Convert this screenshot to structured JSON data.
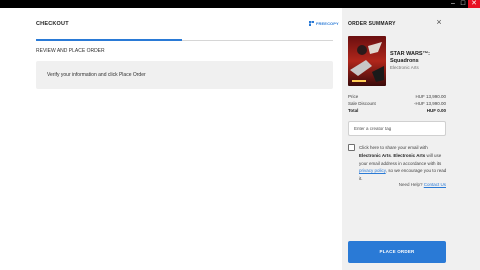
{
  "checkout": {
    "title": "CHECKOUT",
    "brand": "FREECOPY",
    "step": "REVIEW AND PLACE ORDER",
    "info_message": "Verify your information and click Place Order"
  },
  "summary": {
    "title": "ORDER SUMMARY",
    "close": "×",
    "product": {
      "title": "STAR WARS™: Squadrons",
      "publisher": "Electronic Arts"
    },
    "rows": {
      "price": {
        "label": "Price",
        "value": "HUF 13,990.00"
      },
      "discount": {
        "label": "Sale Discount",
        "value": "-HUF 13,990.00"
      },
      "total": {
        "label": "Total",
        "value": "HUF 0.00"
      }
    },
    "creator_tag_placeholder": "Enter a creator tag",
    "consent": {
      "p1": "Click here to share your email with ",
      "b1": "Electronic Arts",
      "p2": ". ",
      "b2": "Electronic Arts",
      "p3": " will use your email address in accordance with its ",
      "link": "privacy policy",
      "p4": ", so we encourage you to read it."
    },
    "help": {
      "text": "Need Help? ",
      "link": "Contact Us"
    },
    "place_order_label": "PLACE ORDER"
  },
  "colors": {
    "accent": "#2a7ad6",
    "panel": "#f0f0f0",
    "titlebar": "#000000"
  }
}
